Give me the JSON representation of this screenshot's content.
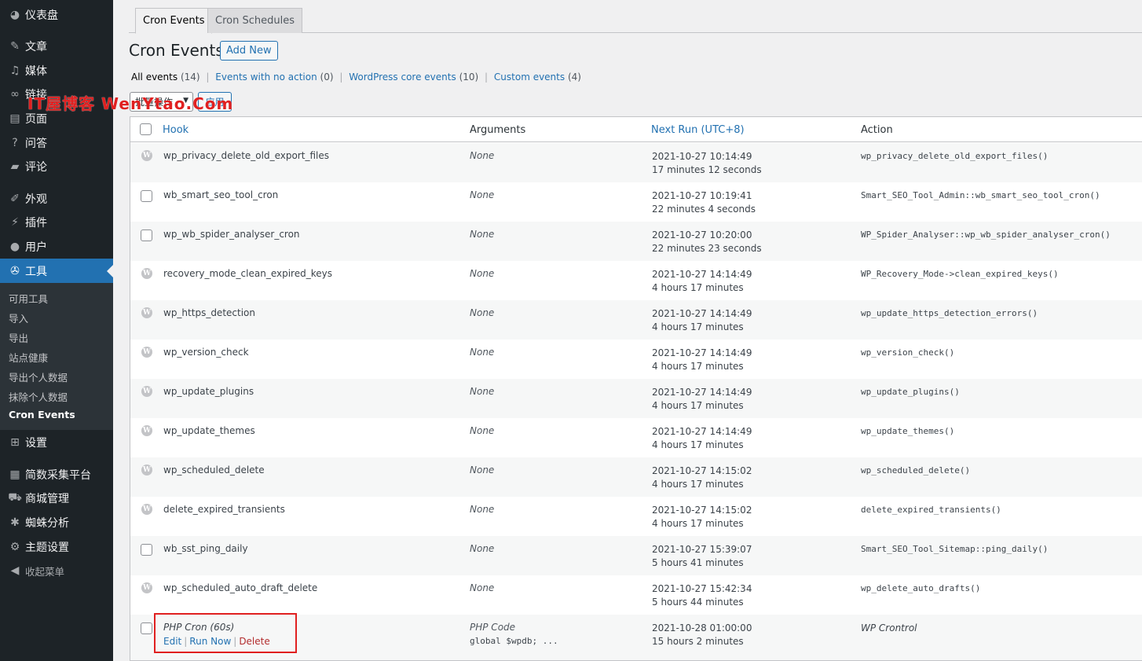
{
  "sidebar": {
    "items": [
      {
        "label": "仪表盘",
        "icon": "dashboard-icon"
      },
      {
        "label": "文章",
        "icon": "pin-icon"
      },
      {
        "label": "媒体",
        "icon": "media-icon"
      },
      {
        "label": "链接",
        "icon": "link-icon"
      },
      {
        "label": "页面",
        "icon": "page-icon"
      },
      {
        "label": "问答",
        "icon": "question-icon"
      },
      {
        "label": "评论",
        "icon": "comment-icon"
      },
      {
        "label": "外观",
        "icon": "brush-icon"
      },
      {
        "label": "插件",
        "icon": "plugin-icon"
      },
      {
        "label": "用户",
        "icon": "user-icon"
      },
      {
        "label": "工具",
        "icon": "wrench-icon",
        "active": true
      },
      {
        "label": "设置",
        "icon": "settings-icon"
      },
      {
        "label": "简数采集平台",
        "icon": "app-icon"
      },
      {
        "label": "商城管理",
        "icon": "cart-icon"
      },
      {
        "label": "蜘蛛分析",
        "icon": "spider-icon"
      },
      {
        "label": "主题设置",
        "icon": "gear-icon"
      },
      {
        "label": "收起菜单",
        "icon": "collapse-icon"
      }
    ],
    "submenu": [
      "可用工具",
      "导入",
      "导出",
      "站点健康",
      "导出个人数据",
      "抹除个人数据",
      "Cron Events"
    ]
  },
  "watermark": "IT屋博客 WenYtao.Com",
  "tabs": [
    "Cron Events",
    "Cron Schedules"
  ],
  "page_title": "Cron Events",
  "add_new": "Add New",
  "filters": {
    "all": "All events",
    "all_count": "(14)",
    "no_action": "Events with no action",
    "no_action_count": "(0)",
    "core": "WordPress core events",
    "core_count": "(10)",
    "custom": "Custom events",
    "custom_count": "(4)"
  },
  "bulk": {
    "select": "批量操作",
    "apply": "应用"
  },
  "table": {
    "headers": {
      "hook": "Hook",
      "args": "Arguments",
      "next": "Next Run (UTC+8)",
      "action": "Action"
    },
    "rows": [
      {
        "hook": "wp_privacy_delete_old_export_files",
        "args": "None",
        "date": "2021-10-27 10:14:49",
        "rel": "17 minutes 12 seconds",
        "action": "wp_privacy_delete_old_export_files()",
        "core": true
      },
      {
        "hook": "wb_smart_seo_tool_cron",
        "args": "None",
        "date": "2021-10-27 10:19:41",
        "rel": "22 minutes 4 seconds",
        "action": "Smart_SEO_Tool_Admin::wb_smart_seo_tool_cron()",
        "core": false
      },
      {
        "hook": "wp_wb_spider_analyser_cron",
        "args": "None",
        "date": "2021-10-27 10:20:00",
        "rel": "22 minutes 23 seconds",
        "action": "WP_Spider_Analyser::wp_wb_spider_analyser_cron()",
        "core": false
      },
      {
        "hook": "recovery_mode_clean_expired_keys",
        "args": "None",
        "date": "2021-10-27 14:14:49",
        "rel": "4 hours 17 minutes",
        "action": "WP_Recovery_Mode->clean_expired_keys()",
        "core": true
      },
      {
        "hook": "wp_https_detection",
        "args": "None",
        "date": "2021-10-27 14:14:49",
        "rel": "4 hours 17 minutes",
        "action": "wp_update_https_detection_errors()",
        "core": true
      },
      {
        "hook": "wp_version_check",
        "args": "None",
        "date": "2021-10-27 14:14:49",
        "rel": "4 hours 17 minutes",
        "action": "wp_version_check()",
        "core": true
      },
      {
        "hook": "wp_update_plugins",
        "args": "None",
        "date": "2021-10-27 14:14:49",
        "rel": "4 hours 17 minutes",
        "action": "wp_update_plugins()",
        "core": true
      },
      {
        "hook": "wp_update_themes",
        "args": "None",
        "date": "2021-10-27 14:14:49",
        "rel": "4 hours 17 minutes",
        "action": "wp_update_themes()",
        "core": true
      },
      {
        "hook": "wp_scheduled_delete",
        "args": "None",
        "date": "2021-10-27 14:15:02",
        "rel": "4 hours 17 minutes",
        "action": "wp_scheduled_delete()",
        "core": true
      },
      {
        "hook": "delete_expired_transients",
        "args": "None",
        "date": "2021-10-27 14:15:02",
        "rel": "4 hours 17 minutes",
        "action": "delete_expired_transients()",
        "core": true
      },
      {
        "hook": "wb_sst_ping_daily",
        "args": "None",
        "date": "2021-10-27 15:39:07",
        "rel": "5 hours 41 minutes",
        "action": "Smart_SEO_Tool_Sitemap::ping_daily()",
        "core": false
      },
      {
        "hook": "wp_scheduled_auto_draft_delete",
        "args": "None",
        "date": "2021-10-27 15:42:34",
        "rel": "5 hours 44 minutes",
        "action": "wp_delete_auto_drafts()",
        "core": true
      }
    ],
    "php_row": {
      "hook": "PHP Cron (60s)",
      "args": "PHP Code",
      "code": "global $wpdb; ...",
      "date": "2021-10-28 01:00:00",
      "rel": "15 hours 2 minutes",
      "action": "WP Crontrol",
      "edit": "Edit",
      "run_now": "Run Now",
      "delete": "Delete"
    }
  }
}
